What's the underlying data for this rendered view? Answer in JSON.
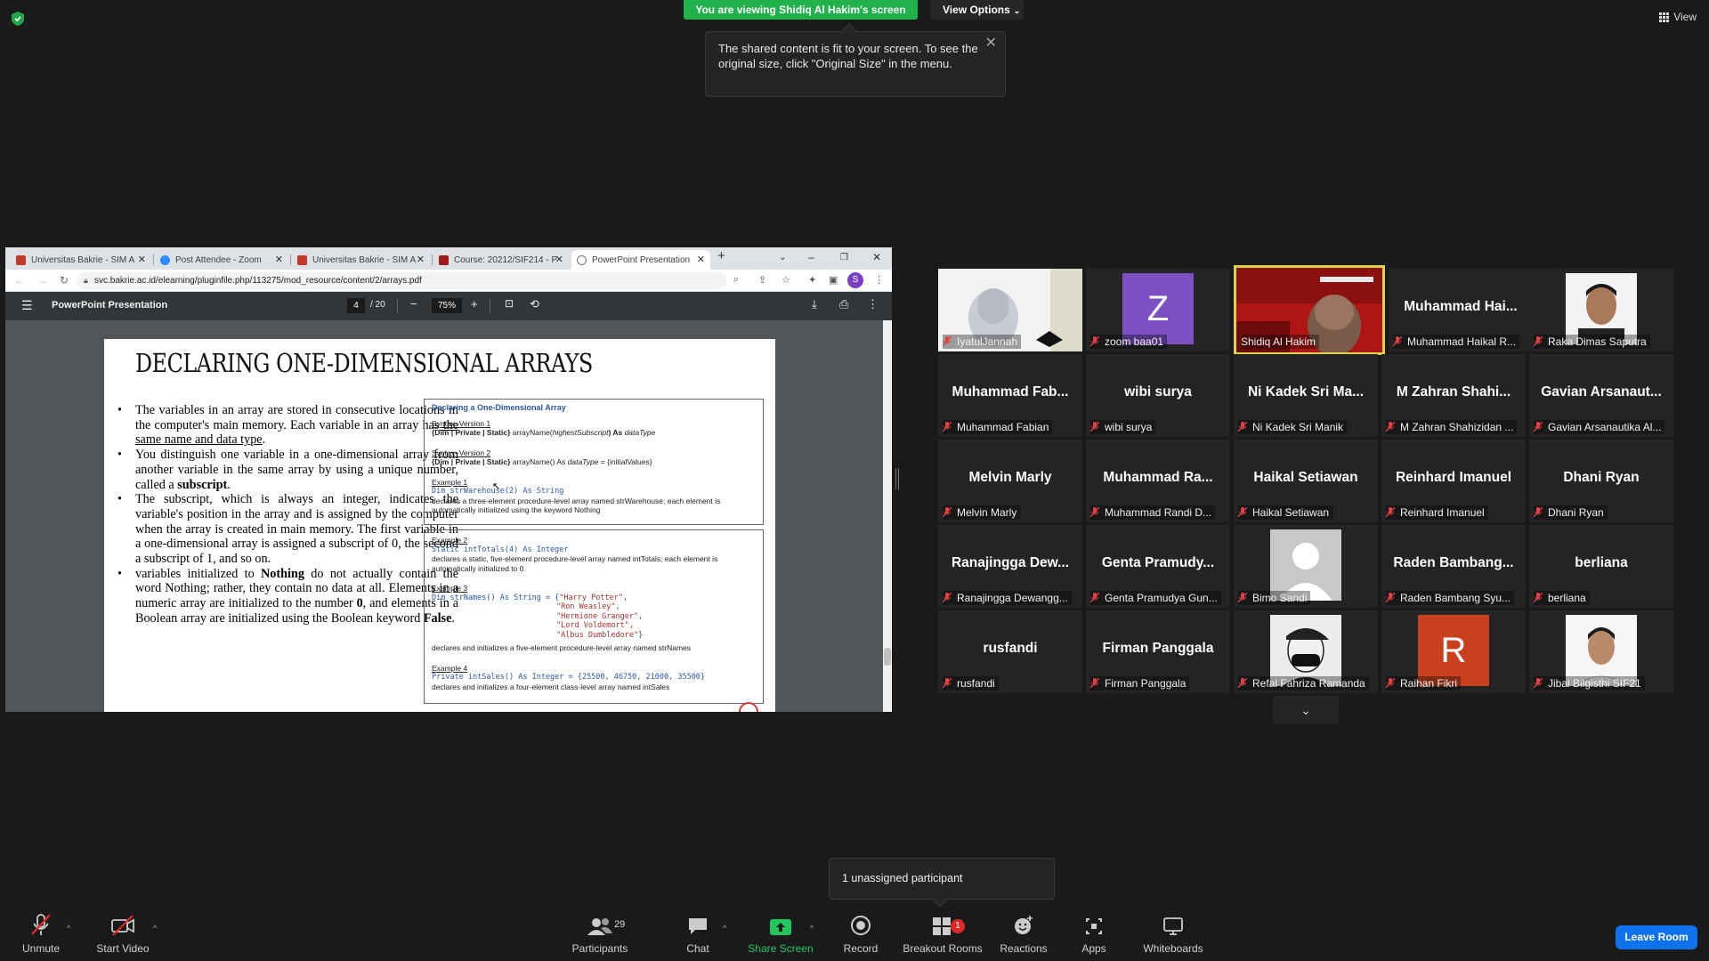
{
  "banner": {
    "viewing": "You are viewing Shidiq Al Hakim's screen",
    "view_options": "View Options",
    "view_top": "View"
  },
  "tooltip": {
    "text": "The shared content is fit to your screen. To see the original size, click \"Original Size\" in the menu."
  },
  "browser": {
    "tabs": [
      {
        "label": "Universitas Bakrie - SIM A",
        "icon": "shield-red-icon"
      },
      {
        "label": "Post Attendee - Zoom",
        "icon": "zoom-icon"
      },
      {
        "label": "Universitas Bakrie - SIM A",
        "icon": "shield-red-icon"
      },
      {
        "label": "Course: 20212/SIF214 - P",
        "icon": "moodle-icon"
      },
      {
        "label": "PowerPoint Presentation",
        "icon": "globe-icon"
      }
    ],
    "url": "svc.bakrie.ac.id/elearning/pluginfile.php/113275/mod_resource/content/2/arrays.pdf",
    "profile_initial": "S"
  },
  "pdf": {
    "title": "PowerPoint Presentation",
    "page": "4",
    "page_total": "/ 20",
    "zoom": "75%"
  },
  "slide": {
    "title": "DECLARING ONE-DIMENSIONAL ARRAYS",
    "b1_pre": "The variables in an array are stored in consecutive locations in the computer's main memory. Each variable in an array has",
    "b1_u": " the same name and data type",
    "b1_post": ".",
    "b2_pre": "You distinguish one variable in a one-dimensional array from another variable in the same array by using a unique number, called a ",
    "b2_b": "subscript",
    "b2_post": ".",
    "b3": "The subscript, which is always an integer, indicates the variable's position in the array and is assigned by the computer when the array is created in main memory. The first variable in a one-dimensional array is assigned a subscript of 0, the second a subscript of 1, and so on.",
    "b4_pre": "variables initialized to ",
    "b4_b1": "Nothing",
    "b4_mid1": " do not actually contain the word Nothing; rather, they contain no data at all. Elements in a numeric array are initialized to the number ",
    "b4_b2": "0",
    "b4_mid2": ", and elements in a Boolean array are initialized using the Boolean keyword ",
    "b4_b3": "False",
    "b4_post": ".",
    "box1": {
      "heading": "Declaring a One-Dimensional Array",
      "syn1_label": "Syntax–Version 1",
      "syn1_kw": "{Dim | Private | Static}",
      "syn1_mid": " arrayName(",
      "syn1_arg": "highestSubscript",
      "syn1_as": ") As ",
      "syn1_type": "dataType",
      "syn2_label": "Syntax–Version 2",
      "syn2_kw": "{Dim | Private | Static}",
      "syn2_mid": " arrayName() As ",
      "syn2_type": "dataType",
      "syn2_end": " = {initialValues}",
      "ex1_label": "Example 1",
      "ex1_code": "Dim strWarehouse(2) As String",
      "ex1_desc": "declares a three-element procedure-level array named strWarehouse; each element is automatically initialized using the keyword Nothing"
    },
    "box2": {
      "ex2_label": "Example 2",
      "ex2_code": "Static intTotals(4) As Integer",
      "ex2_desc": "declares a static, five-element procedure-level array named intTotals; each element is automatically initialized to 0",
      "ex3_label": "Example 3",
      "ex3_code1": "Dim strNames() As String = {",
      "ex3_str1": "\"Harry Potter\",",
      "ex3_str2": "\"Ron Weasley\",",
      "ex3_str3": "\"Hermione Granger\",",
      "ex3_str4": "\"Lord Voldemort\",",
      "ex3_str5": "\"Albus Dumbledore\"",
      "ex3_end": "}",
      "ex3_desc": "declares and initializes a five-element procedure-level array named strNames",
      "ex4_label": "Example 4",
      "ex4_code": "Private intSales() As Integer = {25500, 46750, 21000, 35500}",
      "ex4_desc": "declares and initializes a four-element class-level array named intSales"
    }
  },
  "participants": [
    {
      "big": "",
      "name": "IyatulJannah",
      "avatar": "photo-hijab"
    },
    {
      "big": "",
      "name": "zoom baa01",
      "avatar": "letter-z"
    },
    {
      "big": "",
      "name": "Shidiq Al Hakim",
      "avatar": "video-shidiq",
      "active": true
    },
    {
      "big": "Muhammad Hai...",
      "name": "Muhammad Haikal R..."
    },
    {
      "big": "",
      "name": "Raka Dimas Saputra",
      "avatar": "photo-raka"
    },
    {
      "big": "Muhammad Fab...",
      "name": "Muhammad Fabian"
    },
    {
      "big": "wibi surya",
      "name": "wibi surya"
    },
    {
      "big": "Ni Kadek Sri Ma...",
      "name": "Ni Kadek Sri Manik"
    },
    {
      "big": "M Zahran Shahi...",
      "name": "M Zahran Shahizidan ..."
    },
    {
      "big": "Gavian Arsanaut...",
      "name": "Gavian Arsanautika Al..."
    },
    {
      "big": "Melvin Marly",
      "name": "Melvin Marly"
    },
    {
      "big": "Muhammad Ra...",
      "name": "Muhammad Randi D..."
    },
    {
      "big": "Haikal Setiawan",
      "name": "Haikal Setiawan"
    },
    {
      "big": "Reinhard Imanuel",
      "name": "Reinhard Imanuel"
    },
    {
      "big": "Dhani Ryan",
      "name": "Dhani Ryan"
    },
    {
      "big": "Ranajingga Dew...",
      "name": "Ranajingga Dewangg..."
    },
    {
      "big": "Genta Pramudy...",
      "name": "Genta Pramudya Gun..."
    },
    {
      "big": "",
      "name": "Bimo Sandi",
      "avatar": "photo-default"
    },
    {
      "big": "Raden Bambang...",
      "name": "Raden Bambang Syu..."
    },
    {
      "big": "berliana",
      "name": "berliana"
    },
    {
      "big": "rusfandi",
      "name": "rusfandi"
    },
    {
      "big": "Firman Panggala",
      "name": "Firman Panggala"
    },
    {
      "big": "",
      "name": "Refal Fahriza Ramanda",
      "avatar": "photo-refal"
    },
    {
      "big": "",
      "name": "Raihan Fikri",
      "avatar": "letter-r"
    },
    {
      "big": "",
      "name": "Jibal Bilgisthi SIF21",
      "avatar": "photo-jibal"
    }
  ],
  "unassigned": "1 unassigned participant",
  "toolbar": {
    "unmute": "Unmute",
    "start_video": "Start Video",
    "participants": "Participants",
    "participant_count": "29",
    "chat": "Chat",
    "share_screen": "Share Screen",
    "record": "Record",
    "breakout_rooms": "Breakout Rooms",
    "breakout_badge": "1",
    "reactions": "Reactions",
    "apps": "Apps",
    "whiteboards": "Whiteboards",
    "leave": "Leave Room"
  },
  "colors": {
    "banner_green": "#22b24c",
    "leave_blue": "#0e72ed",
    "active_speaker": "#d8d34a",
    "avatar_z": "#7d4fc4",
    "avatar_r": "#c8401e"
  }
}
